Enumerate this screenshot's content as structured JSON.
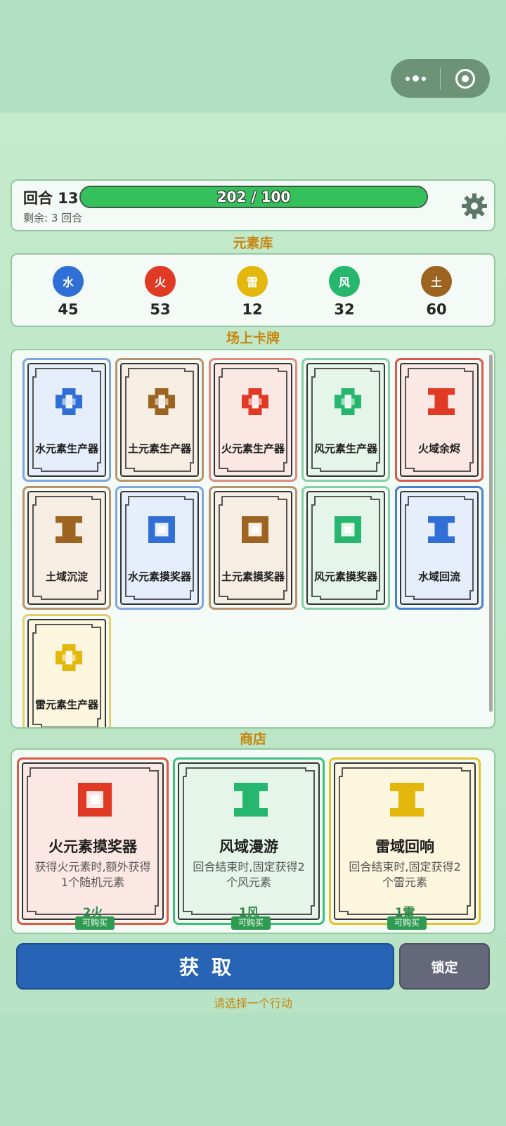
{
  "header": {
    "round_label": "回合 13",
    "progress_text": "202 / 100",
    "progress_fraction": 1.0,
    "remaining": "剩余: 3 回合"
  },
  "sections": {
    "elements": "元素库",
    "field": "场上卡牌",
    "shop": "商店"
  },
  "elements": [
    {
      "symbol": "水",
      "count": "45",
      "color": "#2f6fd6"
    },
    {
      "symbol": "火",
      "count": "53",
      "color": "#e03a24"
    },
    {
      "symbol": "雷",
      "count": "12",
      "color": "#e3b70c"
    },
    {
      "symbol": "风",
      "count": "32",
      "color": "#27b66e"
    },
    {
      "symbol": "土",
      "count": "60",
      "color": "#9c6321"
    }
  ],
  "field_cards": [
    {
      "name": "水元素生产器",
      "icon": "producer-icon",
      "color": "#2f6fd6",
      "border": "#7fa6e0",
      "bg": "#e7eefb"
    },
    {
      "name": "土元素生产器",
      "icon": "producer-icon",
      "color": "#9c6321",
      "border": "#b8946a",
      "bg": "#f6ede3"
    },
    {
      "name": "火元素生产器",
      "icon": "producer-icon",
      "color": "#e03a24",
      "border": "#e28a7c",
      "bg": "#fbe7e3"
    },
    {
      "name": "风元素生产器",
      "icon": "producer-icon",
      "color": "#27b66e",
      "border": "#86cfa5",
      "bg": "#e5f5ea"
    },
    {
      "name": "火域余烬",
      "icon": "domain-icon",
      "color": "#e03a24",
      "border": "#d8584a",
      "bg": "#fbe7e3"
    },
    {
      "name": "土域沉淀",
      "icon": "domain-icon",
      "color": "#9c6321",
      "border": "#b8946a",
      "bg": "#f6ede3"
    },
    {
      "name": "水元素摸奖器",
      "icon": "lottery-icon",
      "color": "#2f6fd6",
      "border": "#7fa6e0",
      "bg": "#e7eefb"
    },
    {
      "name": "土元素摸奖器",
      "icon": "lottery-icon",
      "color": "#9c6321",
      "border": "#b8946a",
      "bg": "#f6ede3"
    },
    {
      "name": "风元素摸奖器",
      "icon": "lottery-icon",
      "color": "#27b66e",
      "border": "#86cfa5",
      "bg": "#e5f5ea"
    },
    {
      "name": "水域回流",
      "icon": "domain-icon",
      "color": "#2f6fd6",
      "border": "#4a7fcf",
      "bg": "#e7eefb"
    },
    {
      "name": "雷元素生产器",
      "icon": "producer-icon",
      "color": "#e3b70c",
      "border": "#e6cf6a",
      "bg": "#fbf6dd"
    }
  ],
  "shop_cards": [
    {
      "name": "火元素摸奖器",
      "desc": "获得火元素时,额外获得1个随机元素",
      "cost": "2火",
      "badge": "可购买",
      "icon": "lottery-icon",
      "color": "#e03a24",
      "border": "#e05a44",
      "bg": "#fbe7e3"
    },
    {
      "name": "风域漫游",
      "desc": "回合结束时,固定获得2个风元素",
      "cost": "1风",
      "badge": "可购买",
      "icon": "domain-icon",
      "color": "#27b66e",
      "border": "#3cc07e",
      "bg": "#e5f5ea"
    },
    {
      "name": "雷域回响",
      "desc": "回合结束时,固定获得2个雷元素",
      "cost": "1雷",
      "badge": "可购买",
      "icon": "domain-icon",
      "color": "#e3b70c",
      "border": "#e6c22a",
      "bg": "#fbf6dd"
    }
  ],
  "actions": {
    "get_label": "获取",
    "lock_label": "锁定",
    "hint": "请选择一个行动"
  }
}
